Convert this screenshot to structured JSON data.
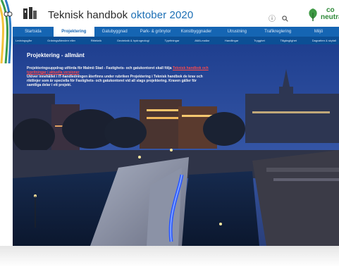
{
  "header": {
    "title_main": "Teknisk handbok",
    "title_highlight": "oktober 2020",
    "logo_icon": "malmo-griffin-logo-icon",
    "info_icon": "info-icon",
    "search_icon": "search-icon",
    "badge_icon": "co2-neutral-leaf-icon",
    "badge_line1": "co",
    "badge_line2": "neutral"
  },
  "mainnav": {
    "items": [
      "Startsida",
      "Projektering",
      "Gatubyggnad",
      "Park- & grönytor",
      "Konstbyggnader",
      "Utrustning",
      "Trafikreglering",
      "Miljö"
    ],
    "active_index": 1
  },
  "subnav": {
    "items": [
      "Ledningsgårr",
      "Gräningsåtenderr eller",
      "Ritteknik",
      "Geoteknik & hydrogeologi",
      "Typritningar",
      "AMA-mallar",
      "Handlingar",
      "Trygghet",
      "Tillgänglighet",
      "Dagvatten & skyfall"
    ]
  },
  "hero": {
    "title": "Projektering - allmänt",
    "text_before_link": "Projekteringsuppdrag utförda för Malmö Stad - Fastighets- och gatukontoret skall följa",
    "link_text": "Teknisk handbok och typritningar i aktuella versioner",
    "text_after_link": "Utöver innehållet i IT-handledningen återfinns under rubriken Projektering i Teknisk handbok de krav och riktlinjer som är speciella för Fastighets- och gatukontoret vid all slags projektering. Kraven gäller för samtliga delar i ett projekt."
  },
  "colors": {
    "nav_blue": "#1565b3",
    "subnav_blue": "#0c4f95",
    "title_accent": "#1c6fb5",
    "link_red": "#ff4a4a",
    "badge_green": "#2f8a3a"
  }
}
